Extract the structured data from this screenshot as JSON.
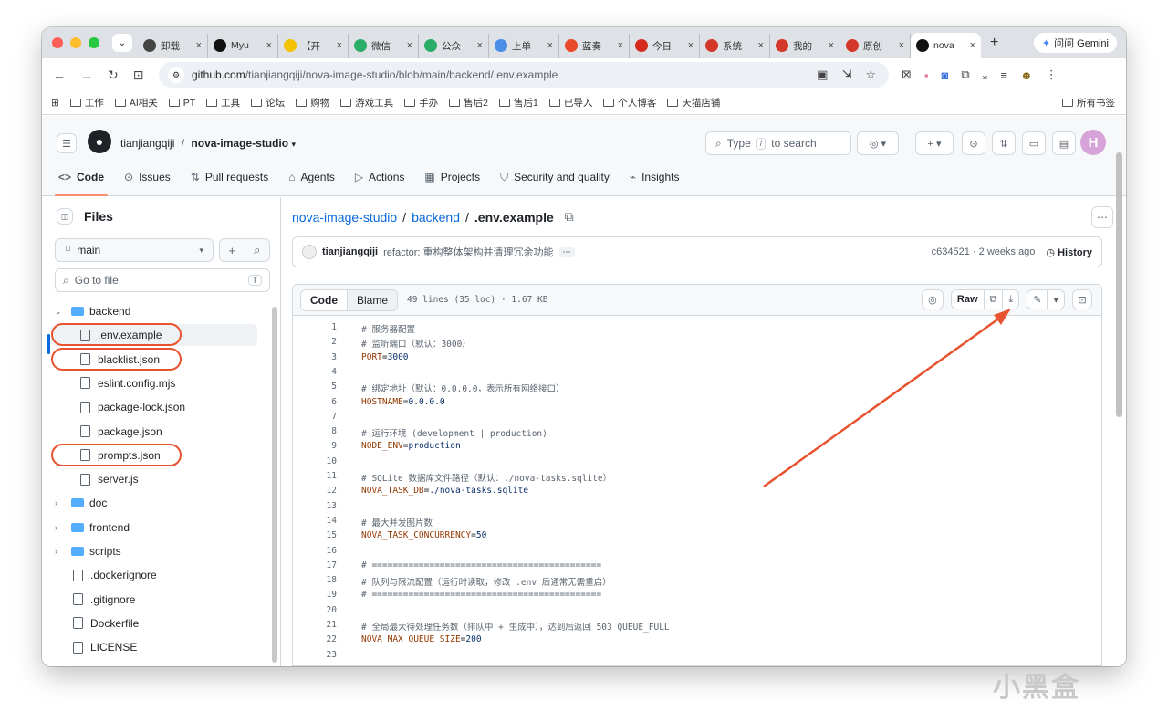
{
  "browser": {
    "tabs": [
      {
        "label": "卸载",
        "color": "#444"
      },
      {
        "label": "Myu",
        "color": "#111"
      },
      {
        "label": "【开",
        "color": "#f2c200"
      },
      {
        "label": "微信",
        "color": "#2aae67"
      },
      {
        "label": "公众",
        "color": "#2aae67"
      },
      {
        "label": "上单",
        "color": "#4a8fe7"
      },
      {
        "label": "蓝奏",
        "color": "#e84a2a"
      },
      {
        "label": "今日",
        "color": "#d52b1e"
      },
      {
        "label": "系统",
        "color": "#d4382b"
      },
      {
        "label": "我的",
        "color": "#d4382b"
      },
      {
        "label": "原创",
        "color": "#d4382b"
      },
      {
        "label": "nova",
        "color": "#111"
      }
    ],
    "gemini_label": "问问 Gemini",
    "url_host": "github.com",
    "url_path": "/tianjiangqiji/nova-image-studio/blob/main/backend/.env.example",
    "bookmarks": [
      "工作",
      "AI相关",
      "PT",
      "工具",
      "论坛",
      "购物",
      "游戏工具",
      "手办",
      "售后2",
      "售后1",
      "已导入",
      "个人博客",
      "天猫店铺"
    ],
    "all_bookmarks": "所有书签"
  },
  "github": {
    "owner": "tianjiangqiji",
    "repo": "nova-image-studio",
    "search_placeholder_a": "Type",
    "search_key": "/",
    "search_placeholder_b": "to search",
    "nav": [
      {
        "label": "Code",
        "icon": "<>"
      },
      {
        "label": "Issues",
        "icon": "⊙"
      },
      {
        "label": "Pull requests",
        "icon": "⇅"
      },
      {
        "label": "Agents",
        "icon": "⌂"
      },
      {
        "label": "Actions",
        "icon": "▷"
      },
      {
        "label": "Projects",
        "icon": "▦"
      },
      {
        "label": "Security and quality",
        "icon": "⛉"
      },
      {
        "label": "Insights",
        "icon": "⌁"
      }
    ]
  },
  "sidebar": {
    "title": "Files",
    "branch": "main",
    "go_to_file": "Go to file",
    "go_to_file_key": "T",
    "tree": [
      {
        "label": "backend",
        "type": "folder-open"
      },
      {
        "label": ".env.example",
        "type": "file"
      },
      {
        "label": "blacklist.json",
        "type": "file"
      },
      {
        "label": "eslint.config.mjs",
        "type": "file"
      },
      {
        "label": "package-lock.json",
        "type": "file"
      },
      {
        "label": "package.json",
        "type": "file"
      },
      {
        "label": "prompts.json",
        "type": "file"
      },
      {
        "label": "server.js",
        "type": "file"
      },
      {
        "label": "doc",
        "type": "folder"
      },
      {
        "label": "frontend",
        "type": "folder"
      },
      {
        "label": "scripts",
        "type": "folder"
      },
      {
        "label": ".dockerignore",
        "type": "file"
      },
      {
        "label": ".gitignore",
        "type": "file"
      },
      {
        "label": "Dockerfile",
        "type": "file"
      },
      {
        "label": "LICENSE",
        "type": "file"
      }
    ]
  },
  "breadcrumb": {
    "repo": "nova-image-studio",
    "dir": "backend",
    "file": ".env.example",
    "sep": "/"
  },
  "commit": {
    "author": "tianjiangqiji",
    "message": "refactor: 重构整体架构并清理冗余功能",
    "hash": "c634521",
    "time": "2 weeks ago",
    "history": "History"
  },
  "viewer": {
    "tab_code": "Code",
    "tab_blame": "Blame",
    "meta": "49 lines (35 loc) · 1.67 KB",
    "raw": "Raw"
  },
  "code": [
    {
      "n": "1",
      "t": "# 服务器配置"
    },
    {
      "n": "2",
      "t": "# 监听端口（默认：3000）"
    },
    {
      "n": "3",
      "k": "PORT",
      "v": "3000"
    },
    {
      "n": "4",
      "t": ""
    },
    {
      "n": "5",
      "t": "# 绑定地址（默认：0.0.0.0，表示所有网络接口）"
    },
    {
      "n": "6",
      "k": "HOSTNAME",
      "v": "0.0.0.0"
    },
    {
      "n": "7",
      "t": ""
    },
    {
      "n": "8",
      "t": "# 运行环境 (development | production)"
    },
    {
      "n": "9",
      "k": "NODE_ENV",
      "v": "production"
    },
    {
      "n": "10",
      "t": ""
    },
    {
      "n": "11",
      "t": "# SQLite 数据库文件路径（默认：./nova-tasks.sqlite）"
    },
    {
      "n": "12",
      "k": "NOVA_TASK_DB",
      "v": "./nova-tasks.sqlite"
    },
    {
      "n": "13",
      "t": ""
    },
    {
      "n": "14",
      "t": "# 最大并发图片数"
    },
    {
      "n": "15",
      "k": "NOVA_TASK_CONCURRENCY",
      "v": "50"
    },
    {
      "n": "16",
      "t": ""
    },
    {
      "n": "17",
      "t": "# ============================================"
    },
    {
      "n": "18",
      "t": "# 队列与限流配置（运行时读取，修改 .env 后通常无需重启）"
    },
    {
      "n": "19",
      "t": "# ============================================"
    },
    {
      "n": "20",
      "t": ""
    },
    {
      "n": "21",
      "t": "# 全局最大待处理任务数（排队中 + 生成中），达到后返回 503 QUEUE_FULL"
    },
    {
      "n": "22",
      "k": "NOVA_MAX_QUEUE_SIZE",
      "v": "200"
    },
    {
      "n": "23",
      "t": ""
    }
  ],
  "watermark": "小黑盒",
  "annotation_color": "#e8532f"
}
